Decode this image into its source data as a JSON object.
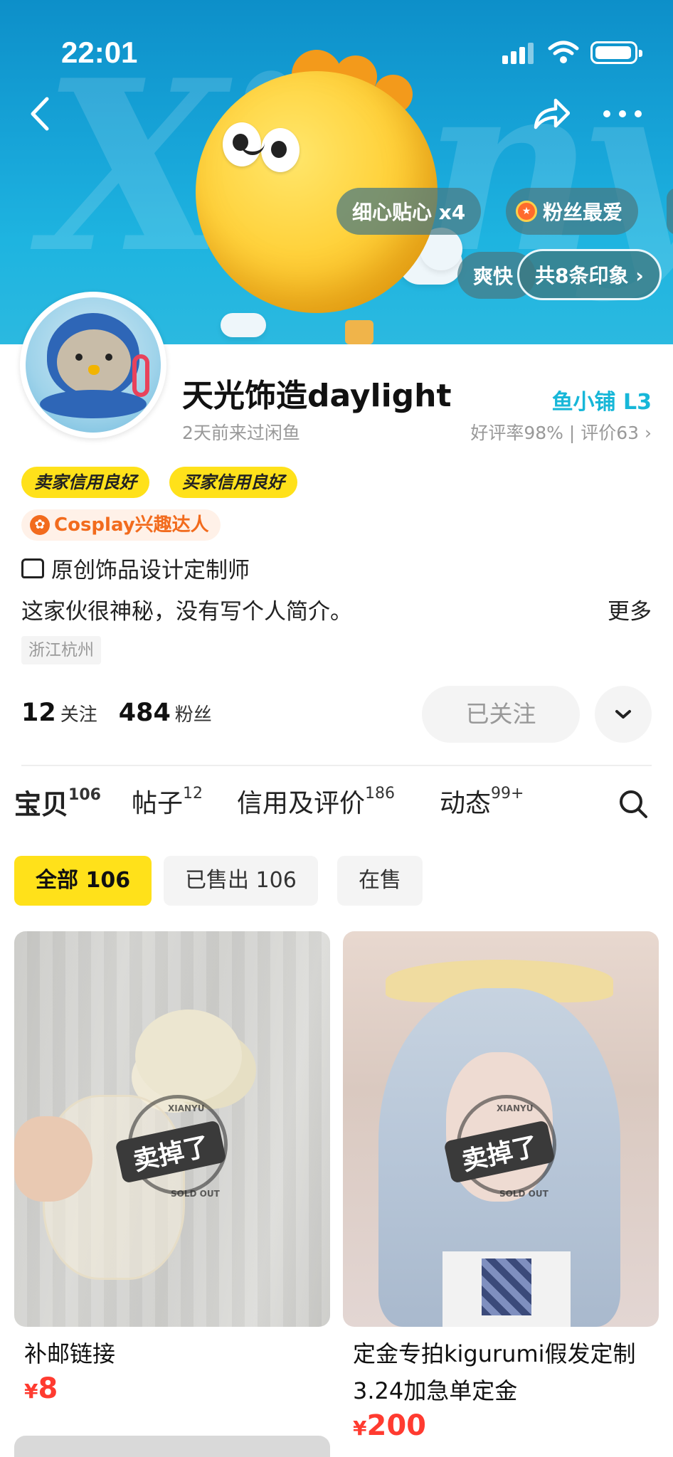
{
  "status_bar": {
    "time": "22:01"
  },
  "banner": {
    "bg_text": "Xianyu",
    "chips": [
      {
        "label": "细心贴心 x4"
      },
      {
        "label": "粉丝最爱",
        "icon": "medal-icon"
      },
      {
        "label": "爽快"
      },
      {
        "label": "共8条印象 ›"
      }
    ]
  },
  "profile": {
    "username": "天光饰造daylight",
    "last_seen": "2天前来过闲鱼",
    "shop_level": "鱼小铺 L3",
    "rating": "好评率98% | 评价63 ›",
    "badges": [
      "卖家信用良好",
      "买家信用良好"
    ],
    "interest_badge": "Cosplay兴趣达人",
    "designer": "原创饰品设计定制师",
    "bio": "这家伙很神秘，没有写个人简介。",
    "more_label": "更多",
    "location": "浙江杭州",
    "following_count": "12",
    "following_label": "关注",
    "followers_count": "484",
    "followers_label": "粉丝",
    "follow_button": "已关注"
  },
  "tabs": [
    {
      "label": "宝贝",
      "count": "106"
    },
    {
      "label": "帖子",
      "count": "12"
    },
    {
      "label": "信用及评价",
      "count": "186"
    },
    {
      "label": "动态",
      "count": "99+"
    }
  ],
  "filters": [
    "全部 106",
    "已售出 106",
    "在售"
  ],
  "items": [
    {
      "title": "补邮链接",
      "currency": "¥",
      "price": "8",
      "stamp": "卖掉了",
      "stamp_top": "XIANYU",
      "stamp_bottom": "SOLD OUT"
    },
    {
      "title": "定金专拍kigurumi假发定制3.24加急单定金",
      "currency": "¥",
      "price": "200",
      "stamp": "卖掉了",
      "stamp_top": "XIANYU",
      "stamp_bottom": "SOLD OUT"
    }
  ],
  "colors": {
    "accent_yellow": "#ffe11a",
    "price_red": "#ff3b30",
    "shop_cyan": "#17b7d8",
    "banner_blue": "#18a6d9"
  }
}
